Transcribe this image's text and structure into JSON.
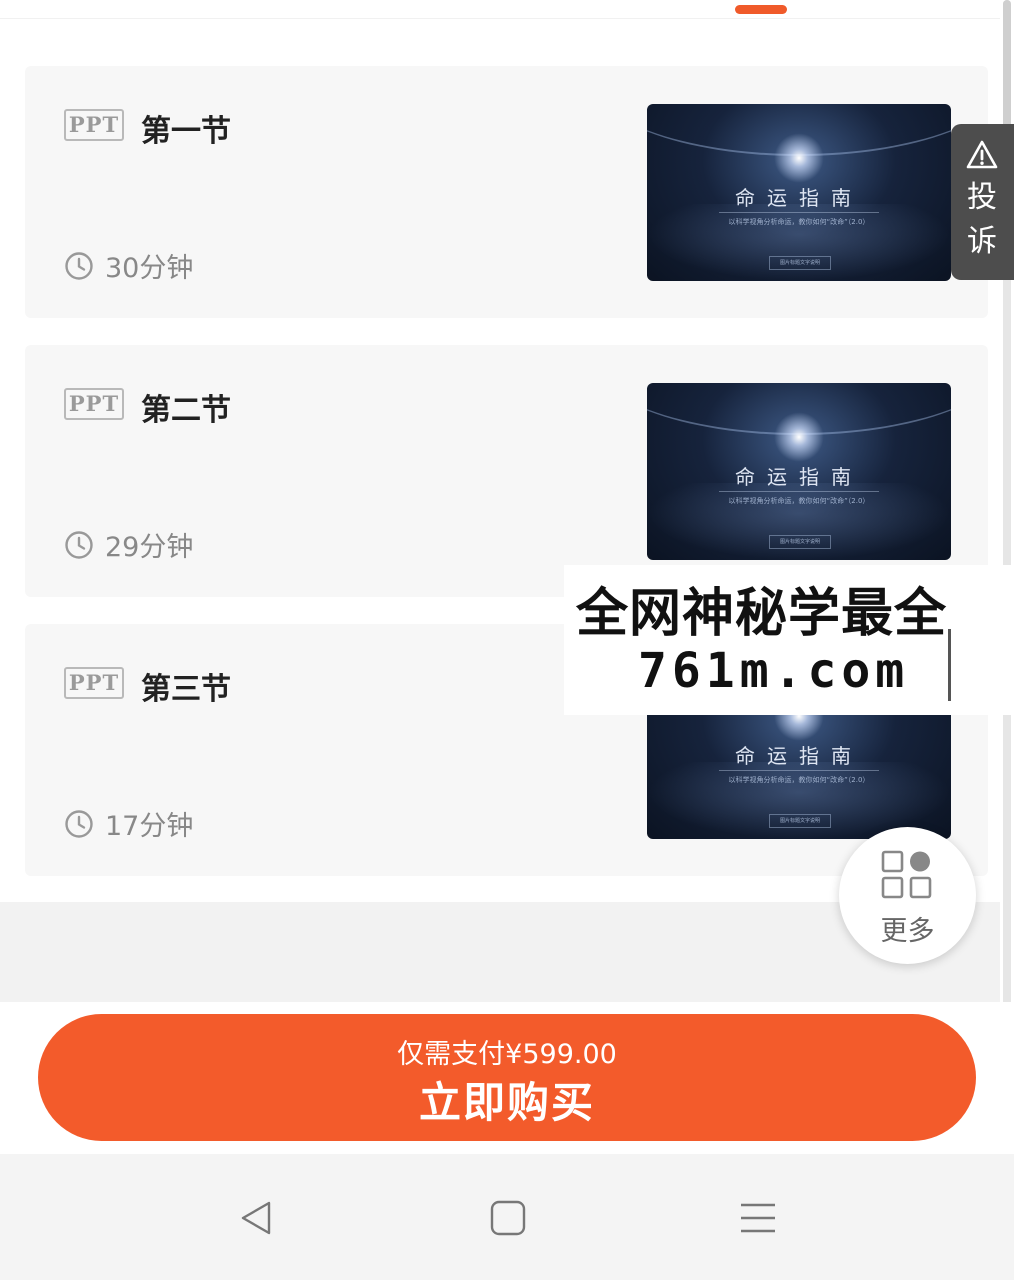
{
  "lessons": [
    {
      "badge": "PPT",
      "title": "第一节",
      "duration": "30分钟",
      "thumbnail": {
        "title": "命运指南",
        "subtitle": "以科学视角分析命运，教你如何“改命”（2.0）",
        "button": "图片标题文字说明"
      }
    },
    {
      "badge": "PPT",
      "title": "第二节",
      "duration": "29分钟",
      "thumbnail": {
        "title": "命运指南",
        "subtitle": "以科学视角分析命运，教你如何“改命”（2.0）",
        "button": "图片标题文字说明"
      }
    },
    {
      "badge": "PPT",
      "title": "第三节",
      "duration": "17分钟",
      "thumbnail": {
        "title": "命运指南",
        "subtitle": "以科学视角分析命运，教你如何“改命”（2.0）",
        "button": "图片标题文字说明"
      }
    }
  ],
  "complaint": {
    "icon": "warning-icon",
    "label": "投诉"
  },
  "watermark": {
    "line1": "全网神秘学最全",
    "line2": "761m.com"
  },
  "more": {
    "icon": "grid-apps-icon",
    "label": "更多"
  },
  "purchase": {
    "price_text": "仅需支付¥599.00",
    "button_label": "立即购买"
  },
  "nav": {
    "back_icon": "back-triangle-icon",
    "home_icon": "home-square-icon",
    "menu_icon": "menu-lines-icon"
  },
  "colors": {
    "accent": "#f35b2b",
    "card_bg": "#f7f7f7",
    "complaint_bg": "#4d4d4d"
  }
}
